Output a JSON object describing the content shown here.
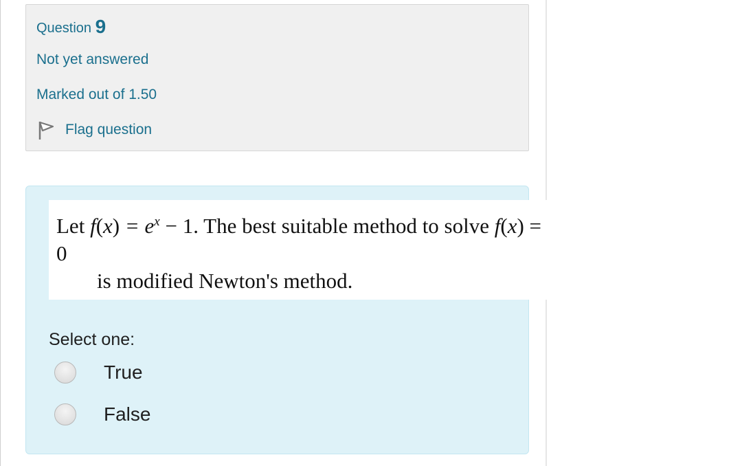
{
  "info": {
    "question_word": "Question",
    "question_number": "9",
    "state": "Not yet answered",
    "grade": "Marked out of 1.50",
    "flag_label": "Flag question"
  },
  "question": {
    "line1_prefix": "Let ",
    "func_f": "f",
    "paren_open": "(",
    "var_x": "x",
    "paren_close": ")",
    "equals_e": " = e",
    "exp_x": "x",
    "line1_after_exp": " − 1. The best suitable method to solve ",
    "func_f2": "f",
    "paren_open2": "(",
    "var_x2": "x",
    "line1_tail": ") = 0",
    "line2": "is modified Newton's method.",
    "prompt": "Select one:",
    "options": [
      {
        "label": "True"
      },
      {
        "label": "False"
      }
    ]
  },
  "colors": {
    "link_text": "#1a6f8d",
    "info_bg": "#f0f0f0",
    "content_bg": "#def2f8"
  },
  "icons": {
    "flag": "flag-icon",
    "radio": "radio-icon"
  }
}
